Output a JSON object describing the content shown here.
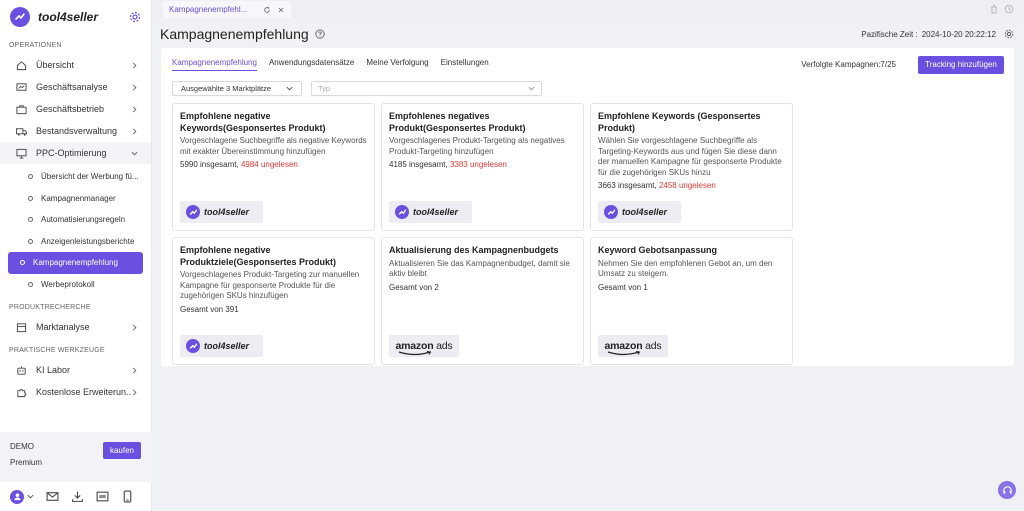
{
  "app": {
    "name": "tool4seller"
  },
  "sidebar": {
    "sections": [
      {
        "title": "OPERATIONEN"
      },
      {
        "title": "PRODUKTRECHERCHE"
      },
      {
        "title": "PRAKTISCHE WERKZEUGE"
      }
    ],
    "items": [
      {
        "label": "Übersicht",
        "icon": "home-icon"
      },
      {
        "label": "Geschäftsanalyse",
        "icon": "chart-icon"
      },
      {
        "label": "Geschäftsbetrieb",
        "icon": "briefcase-icon"
      },
      {
        "label": "Bestandsverwaltung",
        "icon": "truck-icon"
      },
      {
        "label": "PPC-Optimierung",
        "icon": "monitor-icon"
      },
      {
        "label": "Marktanalyse",
        "icon": "box-icon"
      },
      {
        "label": "KI Labor",
        "icon": "robot-icon"
      },
      {
        "label": "Kostenlose Erweiterun...",
        "icon": "puzzle-icon"
      }
    ],
    "ppc_subitems": [
      {
        "label": "Übersicht der Werbung fü..."
      },
      {
        "label": "Kampagnenmanager"
      },
      {
        "label": "Automatisierungsregeln"
      },
      {
        "label": "Anzeigenleistungsberichte"
      },
      {
        "label": "Kampagnenempfehlung"
      },
      {
        "label": "Werbeprotokoll"
      }
    ],
    "plan": {
      "demo": "DEMO",
      "tier": "Premium",
      "buy_label": "kaufen"
    }
  },
  "tab": {
    "label": "Kampagnenempfehl..."
  },
  "header": {
    "title": "Kampagnenempfehlung",
    "time_label": "Pazifische Zeit :",
    "time_value": "2024-10-20 20:22:12"
  },
  "subtabs": [
    "Kampagnenempfehlung",
    "Anwendungsdatensätze",
    "Meine Verfolgung",
    "Einstellungen"
  ],
  "tracking": {
    "label": "Verfolgte Kampagnen:7/25",
    "button": "Tracking hinzufügen"
  },
  "filters": {
    "market": "Ausgewählte 3 Marktplätze",
    "type_placeholder": "Typ"
  },
  "cards": [
    {
      "title": "Empfohlene negative Keywords(Gesponsertes Produkt)",
      "desc": "Vorgeschlagene Suchbegriffe als negative Keywords mit exakter Übereinstimmung hinzufügen",
      "stat": "5990 insgesamt,",
      "stat_red": "4984 ungelesen",
      "brand": "tool4seller"
    },
    {
      "title": "Empfohlenes negatives Produkt(Gesponsertes Produkt)",
      "desc": "Vorgeschlagenes Produkt-Targeting als negatives Produkt-Targeting hinzufügen",
      "stat": "4185 insgesamt,",
      "stat_red": "3383 ungelesen",
      "brand": "tool4seller"
    },
    {
      "title": "Empfohlene Keywords (Gesponsertes Produkt)",
      "desc": "Wählen Sie vorgeschlagene Suchbegriffe als Targeting-Keywords aus und fügen Sie diese dann der manuellen Kampagne für gesponserte Produkte für die zugehörigen SKUs hinzu",
      "stat": "3663 insgesamt,",
      "stat_red": "2458 ungelesen",
      "brand": "tool4seller"
    },
    {
      "title": "Empfohlene negative Produktziele(Gesponsertes Produkt)",
      "desc": "Vorgeschlagenes Produkt-Targeting zur manuellen Kampagne für gesponserte Produkte für die zugehörigen SKUs hinzufügen",
      "stat": "Gesamt von 391",
      "stat_red": "",
      "brand": "tool4seller"
    },
    {
      "title": "Aktualisierung des Kampagnenbudgets",
      "desc": "Aktualisieren Sie das Kampagnenbudget, damit sie aktiv bleibt",
      "stat": "Gesamt von 2",
      "stat_red": "",
      "brand": "amazon ads"
    },
    {
      "title": "Keyword Gebotsanpassung",
      "desc": "Nehmen Sie den empfohlenen Gebot an, um den Umsatz zu steigern.",
      "stat": "Gesamt von 1",
      "stat_red": "",
      "brand": "amazon ads"
    }
  ],
  "brand_text": {
    "tool": "tool4seller",
    "amazon_a": "amazon",
    "amazon_b": "ads"
  },
  "colors": {
    "accent": "#6b4fe0",
    "unread": "#e53935"
  }
}
